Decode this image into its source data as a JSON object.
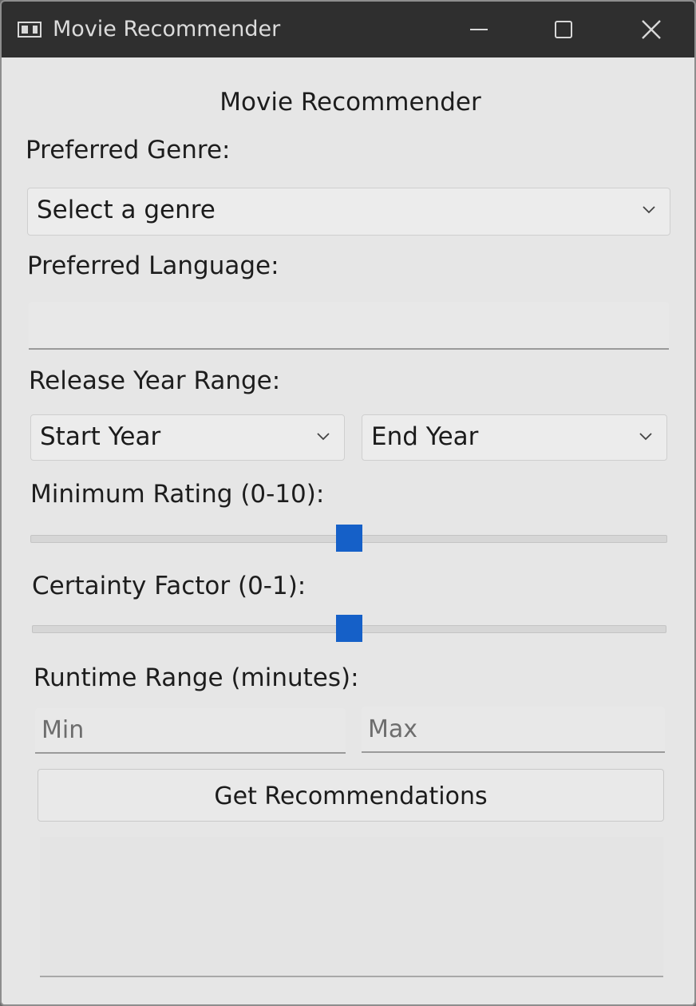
{
  "window": {
    "title": "Movie Recommender",
    "icon": "app-window-icon"
  },
  "heading": "Movie Recommender",
  "genre": {
    "label": "Preferred Genre:",
    "selected": "Select a genre"
  },
  "language": {
    "label": "Preferred Language:",
    "value": ""
  },
  "release_year": {
    "label": "Release Year Range:",
    "start_selected": "Start Year",
    "end_selected": "End Year"
  },
  "min_rating": {
    "label": "Minimum Rating (0-10):",
    "level_fraction": 0.5
  },
  "certainty": {
    "label": "Certainty Factor (0-1):",
    "level_fraction": 0.5
  },
  "runtime": {
    "label": "Runtime Range (minutes):",
    "min_placeholder": "Min",
    "max_placeholder": "Max"
  },
  "submit_label": "Get Recommendations",
  "results_text": "",
  "colors": {
    "slider_thumb": "#1560c8",
    "titlebar": "#2f2f2f"
  }
}
